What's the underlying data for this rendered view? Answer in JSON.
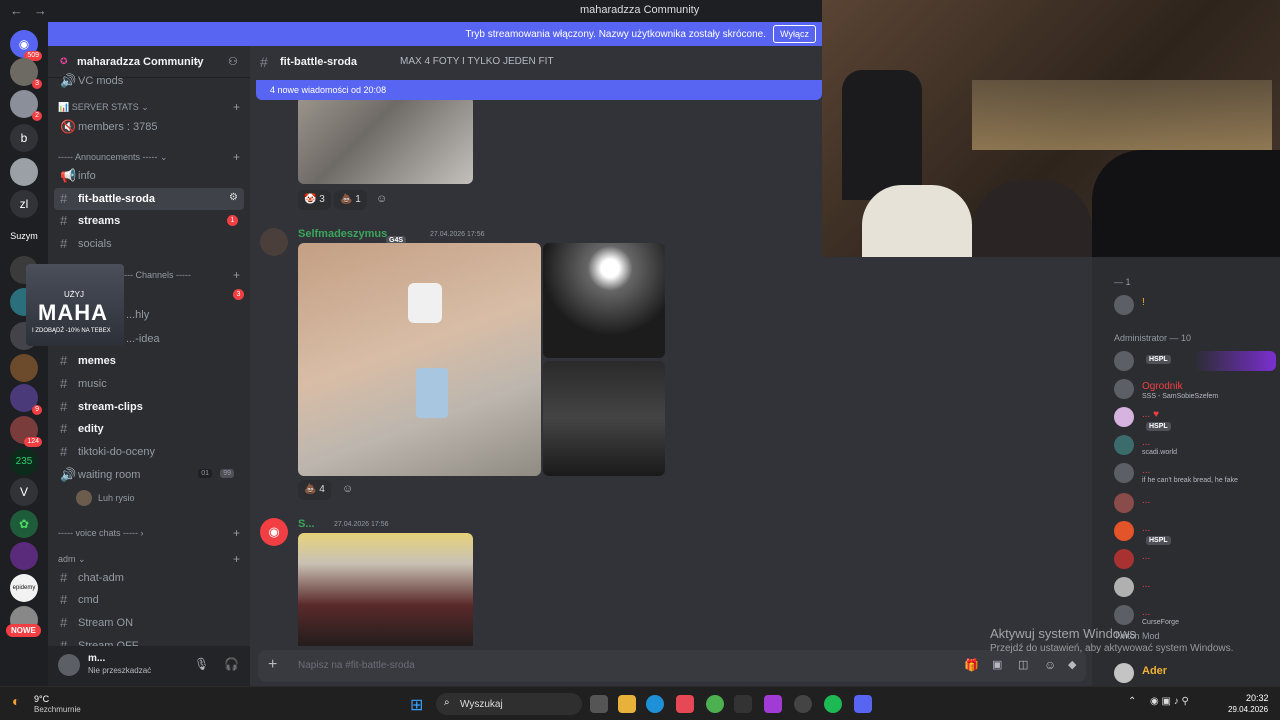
{
  "window": {
    "title": "maharadzza Community",
    "nav_back": "←",
    "nav_fwd": "→"
  },
  "banner": {
    "text": "Tryb streamowania włączony. Nazwy użytkownika zostały skrócone.",
    "button": "Wyłącz"
  },
  "guilds": [
    {
      "label": "",
      "badge": "509"
    },
    {
      "label": "",
      "badge": "3"
    },
    {
      "label": "",
      "badge": "2"
    },
    {
      "label": "b",
      "badge": ""
    },
    {
      "label": "",
      "badge": ""
    },
    {
      "label": "zl",
      "badge": ""
    },
    {
      "label": "Suzym",
      "badge": ""
    },
    {
      "label": "",
      "badge": "9"
    },
    {
      "label": "",
      "badge": "124"
    },
    {
      "label": "235",
      "badge": ""
    },
    {
      "label": "V",
      "badge": ""
    },
    {
      "label": "",
      "badge": ""
    },
    {
      "label": "",
      "badge": ""
    },
    {
      "label": "epidemy",
      "badge": ""
    },
    {
      "label": "NOWE",
      "badge": ""
    }
  ],
  "server": {
    "name": "maharadzza Community",
    "chevron": "⌄"
  },
  "sidebar": {
    "top_partial": "VC mods",
    "stats_cat": "SERVER STATS",
    "members_ch": "members : 3785",
    "ann_cat": "----- Announcements -----",
    "channels": [
      {
        "name": "info",
        "style": ""
      },
      {
        "name": "fit-battle-sroda",
        "style": "active"
      },
      {
        "name": "streams",
        "style": "bold",
        "badge": "1"
      },
      {
        "name": "socials",
        "style": ""
      }
    ],
    "channels_cat": "----- Channels -----",
    "channels_badge": "3",
    "ad_title": "MAHA",
    "ad_sub": "UŻYJ",
    "ad_promo": "I ZDOBĄDŹ -10% NA TEBEX",
    "hidden_ch1": "...hly",
    "hidden_ch2": "...-idea",
    "more_channels": [
      {
        "name": "memes",
        "style": "bold"
      },
      {
        "name": "music",
        "style": ""
      },
      {
        "name": "stream-clips",
        "style": "bold"
      },
      {
        "name": "edity",
        "style": "bold"
      },
      {
        "name": "tiktoki-do-oceny",
        "style": ""
      },
      {
        "name": "waiting room",
        "style": ""
      }
    ],
    "waiting_counts": [
      "01",
      "99"
    ],
    "voice_user": "Luh rysio",
    "voice_cat": "----- voice chats -----",
    "adm_cat": "adm",
    "adm_channels": [
      "chat-adm",
      "cmd",
      "Stream ON",
      "Stream OFF"
    ]
  },
  "user_panel": {
    "name": "m...",
    "status": "Nie przeszkadzać"
  },
  "chat_header": {
    "channel": "fit-battle-sroda",
    "topic": "MAX 4 FOTY I TYLKO JEDEN FIT"
  },
  "new_messages": "4 nowe wiadomości od 20:08",
  "messages": [
    {
      "reactions": [
        {
          "emoji": "🤡",
          "count": "3"
        },
        {
          "emoji": "💩",
          "count": "1"
        }
      ]
    },
    {
      "author": "Selfmadeszymus",
      "tag": "G4S",
      "timestamp": "27.04.2026 17:56",
      "reactions": [
        {
          "emoji": "💩",
          "count": "4"
        }
      ]
    },
    {
      "author": "S...",
      "timestamp": "27.04.2026 17:56"
    }
  ],
  "input_placeholder": "Napisz na #fit-battle-sroda",
  "members": {
    "cat_top": "— 1",
    "top_member": "!",
    "admin_cat": "Administrator — 10",
    "list": [
      {
        "name": "",
        "tag": "HSPL",
        "sub": ""
      },
      {
        "name": "Ogrodnik",
        "tag": "",
        "sub": "SSS - SamSobieSzefem"
      },
      {
        "name": "...",
        "tag": "HSPL",
        "sub": ""
      },
      {
        "name": "...",
        "tag": "",
        "sub": "scadi.world"
      },
      {
        "name": "...",
        "tag": "",
        "sub": "if he can't break bread, he fake"
      },
      {
        "name": "...",
        "tag": "",
        "sub": ""
      },
      {
        "name": "...",
        "tag": "HSPL",
        "sub": ""
      },
      {
        "name": "...",
        "tag": "",
        "sub": ""
      },
      {
        "name": "...",
        "tag": "",
        "sub": ""
      },
      {
        "name": "...",
        "tag": "",
        "sub": "CurseForge"
      }
    ],
    "twitch_cat": "Twitch Mod",
    "bottom_member": "Ader"
  },
  "activation": {
    "line1": "Aktywuj system Windows",
    "line2": "Przejdź do ustawień, aby aktywować system Windows."
  },
  "taskbar": {
    "weather_temp": "9°C",
    "weather_desc": "Bezchmurnie",
    "search": "Wyszukaj",
    "time": "20:32",
    "date": "29.04.2026"
  },
  "colors": {
    "accent": "#5865f2",
    "red": "#f23f43",
    "green": "#23a55a",
    "author": "#3ba55c"
  }
}
